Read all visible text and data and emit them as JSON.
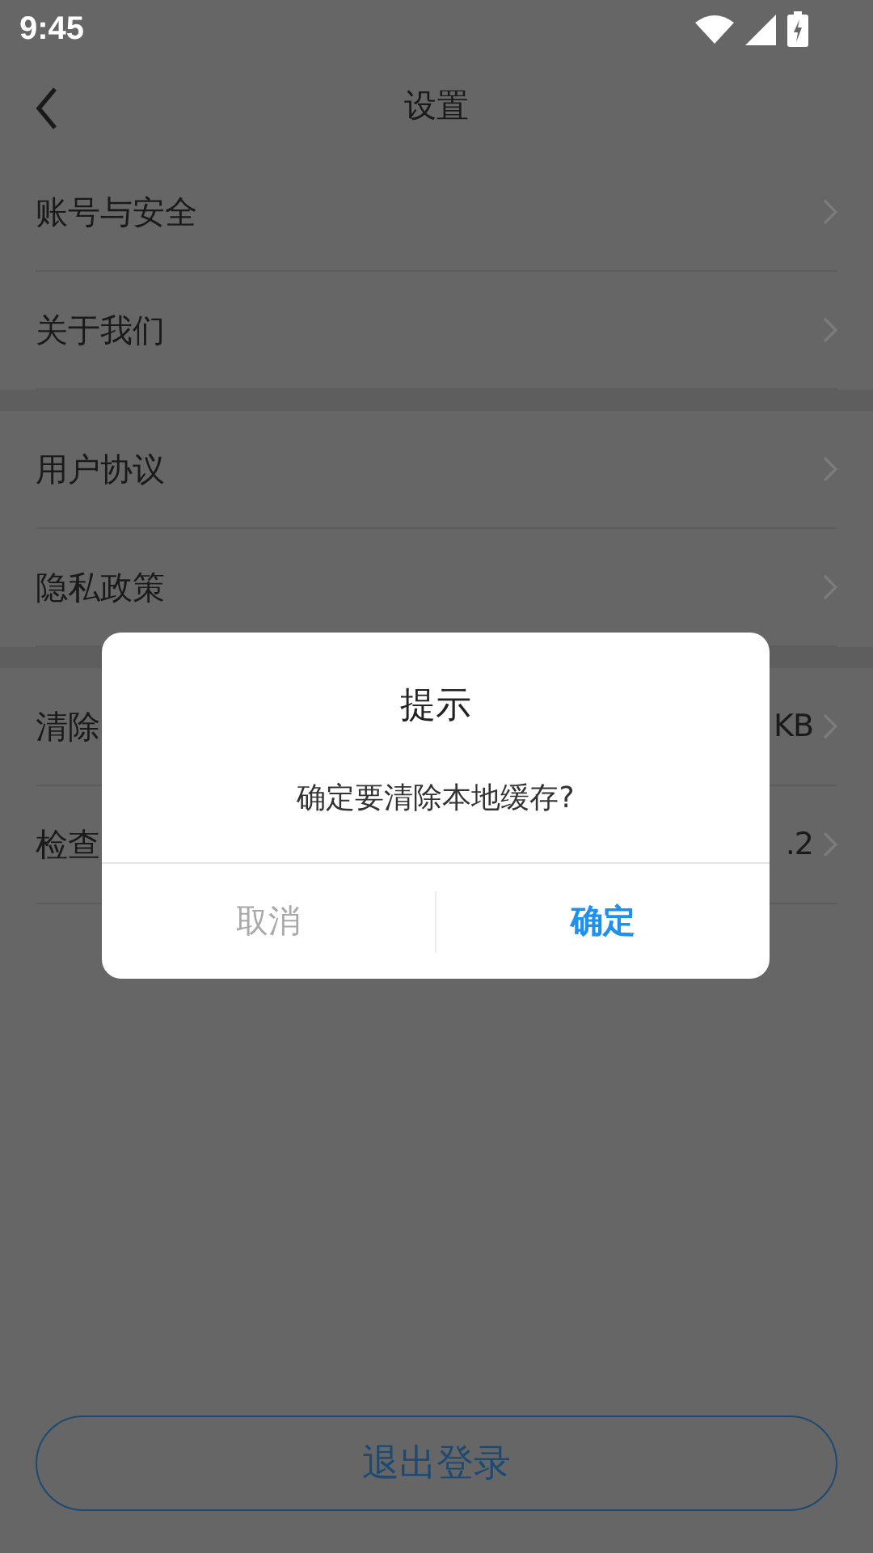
{
  "status_bar": {
    "time": "9:45"
  },
  "header": {
    "title": "设置"
  },
  "groups": [
    {
      "rows": [
        {
          "label": "账号与安全"
        },
        {
          "label": "关于我们"
        }
      ]
    },
    {
      "rows": [
        {
          "label": "用户协议"
        },
        {
          "label": "隐私政策"
        }
      ]
    },
    {
      "rows": [
        {
          "label": "清除",
          "value": "KB"
        },
        {
          "label": "检查",
          "value": ".2"
        }
      ]
    }
  ],
  "logout_button": "退出登录",
  "dialog": {
    "title": "提示",
    "message": "确定要清除本地缓存?",
    "buttons": [
      {
        "label": "取消",
        "kind": "cancel"
      },
      {
        "label": "确定",
        "kind": "confirm"
      }
    ]
  }
}
